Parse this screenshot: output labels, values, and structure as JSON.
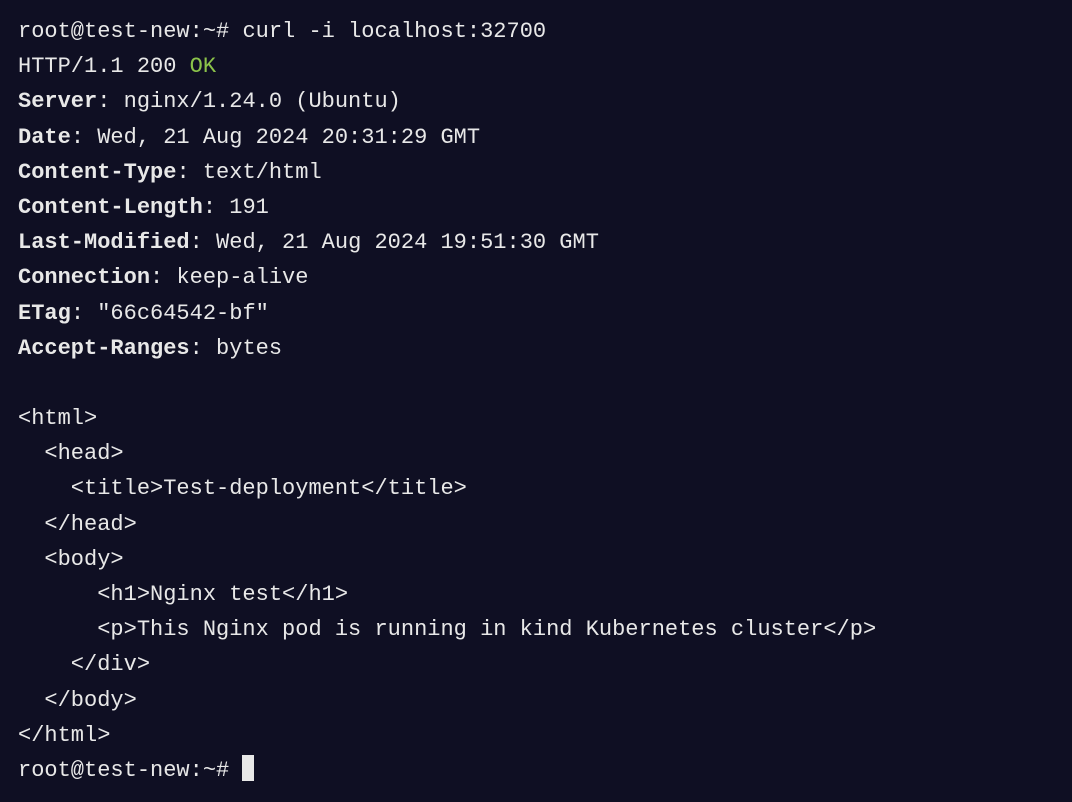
{
  "prompt1": {
    "user": "root@test-new",
    "path": "~",
    "symbol": "#",
    "command": "curl -i localhost:32700"
  },
  "status_line": {
    "protocol": "HTTP/1.1",
    "code": "200",
    "text": "OK"
  },
  "headers": {
    "server": {
      "name": "Server",
      "value": "nginx/1.24.0 (Ubuntu)"
    },
    "date": {
      "name": "Date",
      "value": "Wed, 21 Aug 2024 20:31:29 GMT"
    },
    "content_type": {
      "name": "Content-Type",
      "value": "text/html"
    },
    "content_length": {
      "name": "Content-Length",
      "value": "191"
    },
    "last_modified": {
      "name": "Last-Modified",
      "value": "Wed, 21 Aug 2024 19:51:30 GMT"
    },
    "connection": {
      "name": "Connection",
      "value": "keep-alive"
    },
    "etag": {
      "name": "ETag",
      "value": "\"66c64542-bf\""
    },
    "accept_ranges": {
      "name": "Accept-Ranges",
      "value": "bytes"
    }
  },
  "body_lines": {
    "l1": "<html>",
    "l2": "  <head>",
    "l3": "    <title>Test-deployment</title>",
    "l4": "  </head>",
    "l5": "  <body>",
    "l6": "      <h1>Nginx test</h1>",
    "l7": "      <p>This Nginx pod is running in kind Kubernetes cluster</p>",
    "l8": "    </div>",
    "l9": "  </body>",
    "l10": "</html>"
  },
  "prompt2": {
    "user": "root@test-new",
    "path": "~",
    "symbol": "#"
  }
}
